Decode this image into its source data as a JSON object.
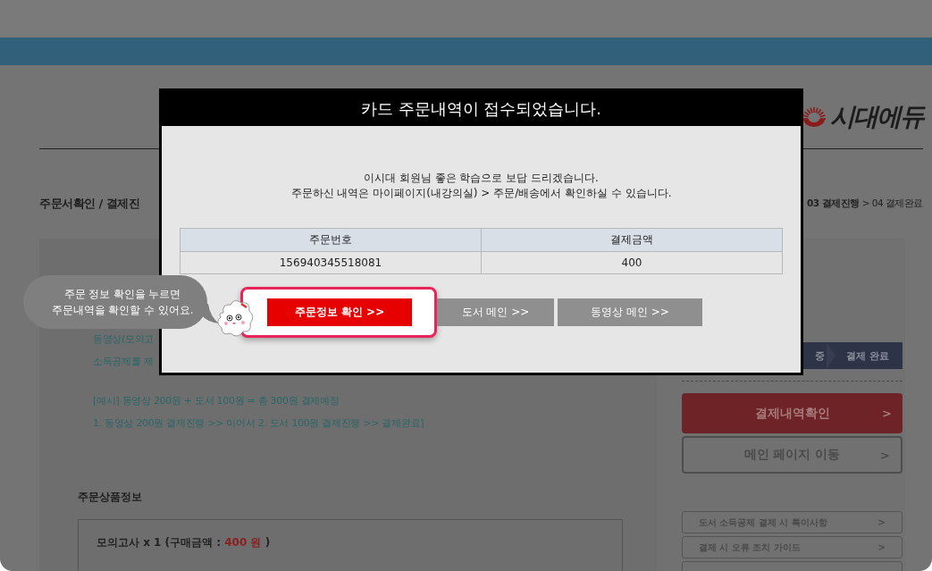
{
  "logo": {
    "text": "시대에듀"
  },
  "page_title": "주문서확인 / 결제진",
  "breadcrumb": "**03 결제진행** > 04 결제완료",
  "notice_lines": [
    "동영상(모의고",
    "소득공제를 제"
  ],
  "example_lines": [
    "[예시] 동영상 200원 + 도서 100원 = 총 300원 결제예정",
    "1. 동영상 200원 결제진행 >> 이어서 2. 도서 100원 결제진행 >> 결제완료]"
  ],
  "products": {
    "title": "주문상품정보",
    "item": "모의고사 x 1 (구매금액 : ",
    "price": "400 원",
    "item_end": " )"
  },
  "steps": [
    {
      "label": "중"
    },
    {
      "label": "결제 완료"
    }
  ],
  "side_buttons": [
    {
      "label": "결제내역확인",
      "kind": "primary",
      "arrow": ">"
    },
    {
      "label": "메인 페이지 이동",
      "kind": "outline",
      "arrow": ">"
    }
  ],
  "side_links": [
    {
      "kind": "link",
      "label": "도서 소득공제 결제 시 특이사항",
      "arrow": ">"
    },
    {
      "kind": "link",
      "label": "결제 시 오류 조치 가이드",
      "arrow": ">"
    },
    {
      "kind": "empty"
    }
  ],
  "modal": {
    "title": "카드 주문내역이 접수되었습니다.",
    "message": [
      "이시대 회원님 좋은 학습으로 보답 드리겠습니다.",
      "주문하신 내역은 마이페이지(내강의실) > 주문/배송에서 확인하실 수 있습니다."
    ],
    "table": {
      "columns": [
        "주문번호",
        "결제금액"
      ],
      "row": [
        "156940345518081",
        "400"
      ]
    },
    "buttons": [
      {
        "label": "주문정보 확인 >>",
        "kind": "primary"
      },
      {
        "label": "도서 메인 >>",
        "kind": "secondary"
      },
      {
        "label": "동영상 메인 >>",
        "kind": "secondary"
      }
    ]
  },
  "tooltip": {
    "lines": [
      "주문 정보 확인을 누르면",
      "주문내역을 확인할 수 있어요."
    ]
  }
}
